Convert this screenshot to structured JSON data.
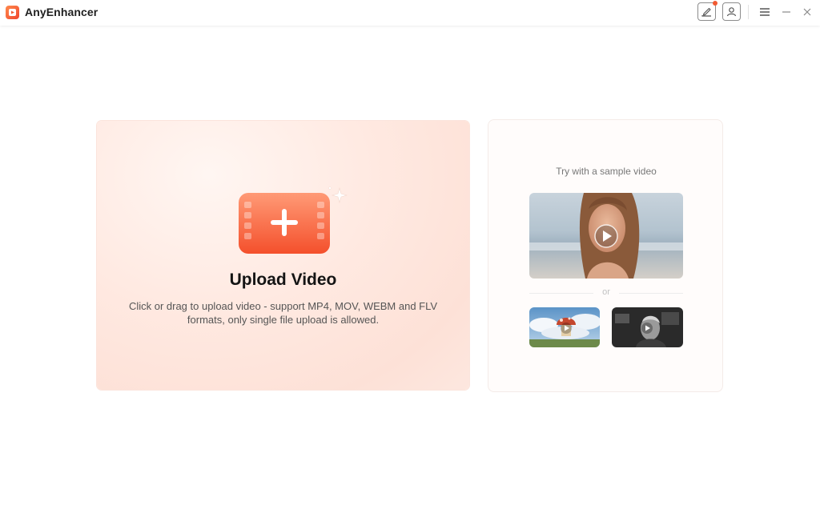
{
  "app": {
    "title": "AnyEnhancer"
  },
  "titlebar": {
    "icons": [
      "feedback-edit-icon",
      "account-icon",
      "menu-icon",
      "minimize-icon",
      "close-icon"
    ],
    "notification_dot_color": "#f25a32"
  },
  "upload": {
    "title": "Upload Video",
    "description": "Click or drag to upload video - support MP4, MOV, WEBM and FLV formats, only single file upload is allowed.",
    "icon": "film-plus-icon",
    "accent_color": "#f5552f"
  },
  "samples": {
    "label": "Try with a sample video",
    "separator": "or",
    "videos": [
      {
        "name": "sample-woman-beach",
        "icon": "play-icon"
      },
      {
        "name": "sample-mushroom-house",
        "icon": "play-icon"
      },
      {
        "name": "sample-bw-man",
        "icon": "play-icon"
      }
    ]
  }
}
